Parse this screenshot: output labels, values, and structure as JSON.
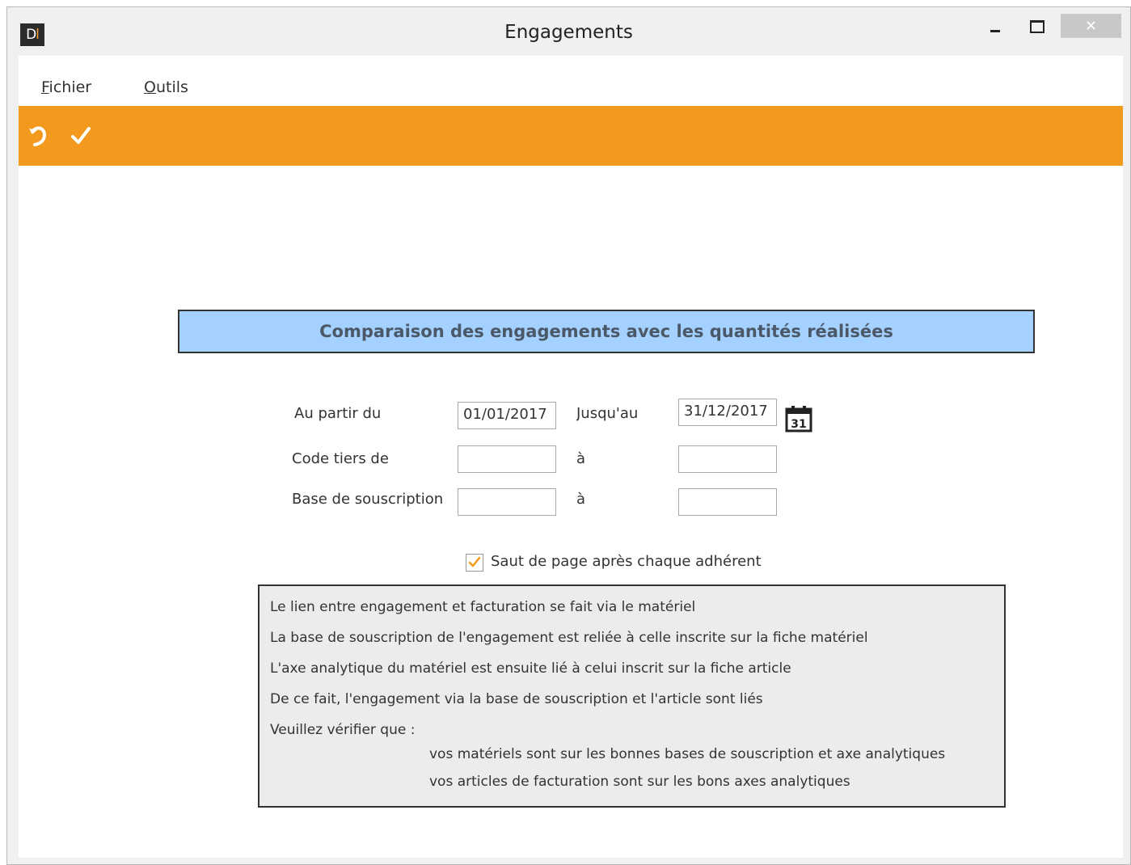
{
  "window": {
    "title": "Engagements",
    "logo_text_dark": "D",
    "logo_text_accent": "l",
    "close_glyph": "✕"
  },
  "menu": {
    "items": [
      {
        "mnemonic": "F",
        "rest": "ichier"
      },
      {
        "mnemonic": "O",
        "rest": "utils"
      }
    ]
  },
  "toolbar": {
    "color": "#f39a1e",
    "icons": [
      "undo-icon",
      "check-icon"
    ]
  },
  "banner": {
    "title": "Comparaison des engagements avec les quantités réalisées",
    "color": "#a4d1ff"
  },
  "form": {
    "date_from_label": "Au partir du",
    "date_from_value": "01/01/2017",
    "date_to_label": "Jusqu'au",
    "date_to_value": "31/12/2017",
    "calendar_day": "31",
    "code_tiers_label": "Code tiers de",
    "code_tiers_from": "",
    "code_tiers_sep": "à",
    "code_tiers_to": "",
    "base_label": "Base de souscription",
    "base_from": "",
    "base_sep": "à",
    "base_to": "",
    "page_break_label": "Saut de page après chaque adhérent",
    "page_break_checked": true
  },
  "info": {
    "lines": [
      "Le lien entre engagement et facturation se fait via le matériel",
      "La base de souscription de l'engagement est reliée à celle inscrite sur la fiche matériel",
      "L'axe analytique du matériel est ensuite lié à celui inscrit sur la fiche article",
      "De ce fait, l'engagement via la base de souscription et l'article sont liés",
      "Veuillez vérifier que :"
    ],
    "bullets": [
      "vos matériels sont sur les bonnes bases de souscription et axe analytiques",
      "vos articles de facturation sont sur les bons axes analytiques"
    ]
  }
}
